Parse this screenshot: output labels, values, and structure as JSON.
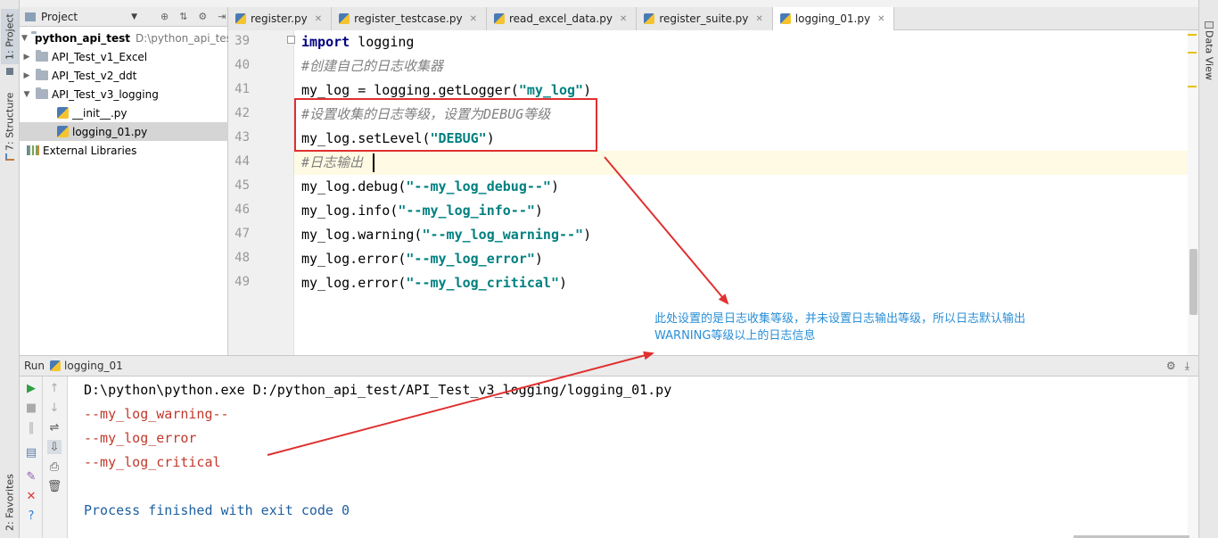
{
  "left_tool_strip": {
    "project_tab": "1: Project",
    "structure_tab": "7: Structure",
    "favorites_tab": "2: Favorites"
  },
  "right_tool_strip": {
    "data_view_tab": "Data View"
  },
  "project_panel": {
    "title": "Project",
    "tree": [
      {
        "label": "python_api_test",
        "hint": "D:\\python_api_test",
        "kind": "folder",
        "expanded": true
      },
      {
        "label": "API_Test_v1_Excel",
        "kind": "folder",
        "expanded": false
      },
      {
        "label": "API_Test_v2_ddt",
        "kind": "folder",
        "expanded": false
      },
      {
        "label": "API_Test_v3_logging",
        "kind": "folder",
        "expanded": true
      },
      {
        "label": "__init__.py",
        "kind": "py"
      },
      {
        "label": "logging_01.py",
        "kind": "py",
        "selected": true
      },
      {
        "label": "External Libraries",
        "kind": "lib"
      }
    ]
  },
  "editor_tabs": [
    {
      "label": "register.py"
    },
    {
      "label": "register_testcase.py"
    },
    {
      "label": "read_excel_data.py"
    },
    {
      "label": "register_suite.py"
    },
    {
      "label": "logging_01.py",
      "active": true
    }
  ],
  "editor": {
    "line_numbers": [
      "39",
      "40",
      "41",
      "42",
      "43",
      "44",
      "45",
      "46",
      "47",
      "48",
      "49"
    ],
    "lines": {
      "l39_kw": "import",
      "l39_rest": " logging",
      "l40_comment": "#创建自己的日志收集器",
      "l41_code": "my_log = logging.getLogger(",
      "l41_str": "\"my_log\"",
      "l41_end": ")",
      "l42_comment": "#设置收集的日志等级，设置为DEBUG等级",
      "l43_code": "my_log.setLevel(",
      "l43_str": "\"DEBUG\"",
      "l43_end": ")",
      "l44_comment": "#日志输出",
      "l45_code": "my_log.debug(",
      "l45_str": "\"--my_log_debug--\"",
      "l45_end": ")",
      "l46_code": "my_log.info(",
      "l46_str": "\"--my_log_info--\"",
      "l46_end": ")",
      "l47_code": "my_log.warning(",
      "l47_str": "\"--my_log_warning--\"",
      "l47_end": ")",
      "l48_code": "my_log.error(",
      "l48_str": "\"--my_log_error\"",
      "l48_end": ")",
      "l49_code": "my_log.error(",
      "l49_str": "\"--my_log_critical\"",
      "l49_end": ")"
    }
  },
  "annotation": {
    "line1": "此处设置的是日志收集等级，并未设置日志输出等级，所以日志默认输出",
    "line2": "WARNING等级以上的日志信息"
  },
  "run_panel": {
    "label": "Run",
    "config": "logging_01",
    "console": {
      "command": "D:\\python\\python.exe D:/python_api_test/API_Test_v3_logging/logging_01.py",
      "output": [
        "--my_log_warning--",
        "--my_log_error",
        "--my_log_critical"
      ],
      "exit": "Process finished with exit code 0"
    }
  },
  "colors": {
    "annotation_red": "#e03030",
    "annotation_blue": "#2a8fd6",
    "keyword": "#000080",
    "string": "#008080",
    "comment": "#808080",
    "console_error": "#c0392b"
  }
}
